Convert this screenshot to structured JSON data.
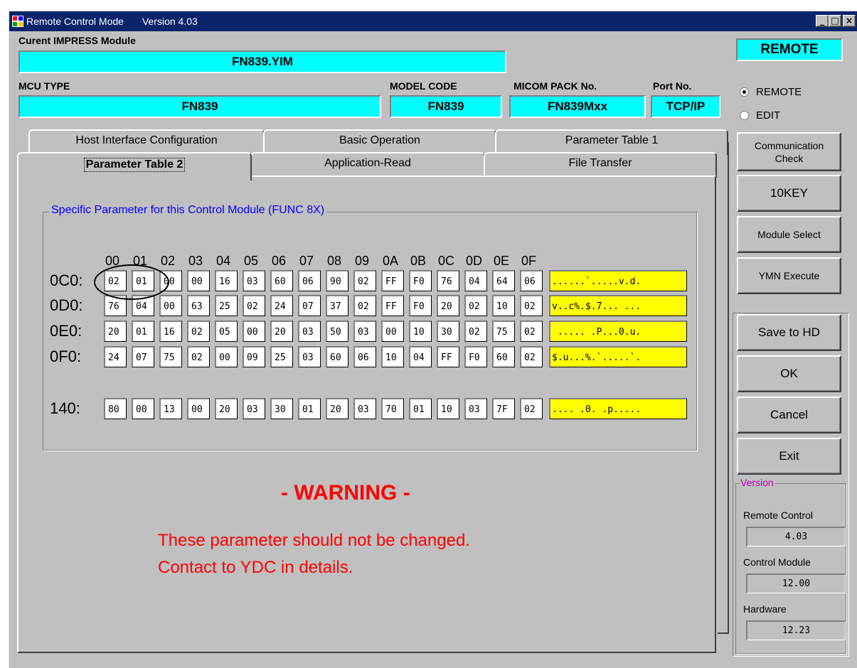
{
  "window": {
    "title": "Remote Control Mode",
    "version_label": "Version  4.03",
    "buttons": [
      "_",
      "□",
      "×"
    ]
  },
  "module": {
    "label": "Curent IMPRESS Module",
    "value": "FN839.YIM"
  },
  "fields": {
    "mcu_type_label": "MCU TYPE",
    "mcu_type": "FN839",
    "model_code_label": "MODEL CODE",
    "model_code": "FN839",
    "micom_pack_label": "MICOM PACK No.",
    "micom_pack": "FN839Mxx",
    "port_label": "Port No.",
    "port": "TCP/IP"
  },
  "mode": {
    "status": "REMOTE",
    "options": [
      {
        "label": "REMOTE",
        "selected": true
      },
      {
        "label": "EDIT",
        "selected": false
      }
    ]
  },
  "side_buttons": {
    "communication_check": [
      "Communication",
      "Check"
    ],
    "tenkey": "10KEY",
    "module_select": "Module Select",
    "ymn_execute": "YMN Execute",
    "save_to_hd": "Save to HD",
    "ok": "OK",
    "cancel": "Cancel",
    "exit": "Exit"
  },
  "version_panel": {
    "title": "Version",
    "remote_control_label": "Remote Control",
    "remote_control": "4.03",
    "control_module_label": "Control Module",
    "control_module": "12.00",
    "hardware_label": "Hardware",
    "hardware": "12.23"
  },
  "tabs": {
    "back_row": [
      "Host Interface Configuration",
      "Basic Operation",
      "Parameter Table 1"
    ],
    "front_row": [
      "Parameter Table 2",
      "Application-Read",
      "File Transfer"
    ],
    "active": "Parameter Table 2"
  },
  "params": {
    "group_title": "Specific Parameter for this Control Module (FUNC 8X)",
    "columns": [
      "00",
      "01",
      "02",
      "03",
      "04",
      "05",
      "06",
      "07",
      "08",
      "09",
      "0A",
      "0B",
      "0C",
      "0D",
      "0E",
      "0F"
    ],
    "rows": [
      {
        "label": "0C0:",
        "cells": [
          "02",
          "01",
          "00",
          "00",
          "16",
          "03",
          "60",
          "06",
          "90",
          "02",
          "FF",
          "F0",
          "76",
          "04",
          "64",
          "06"
        ],
        "ascii": "......`.....v.d."
      },
      {
        "label": "0D0:",
        "cells": [
          "76",
          "04",
          "00",
          "63",
          "25",
          "02",
          "24",
          "07",
          "37",
          "02",
          "FF",
          "F0",
          "20",
          "02",
          "10",
          "02"
        ],
        "ascii": "v..c%.$.7... ..."
      },
      {
        "label": "0E0:",
        "cells": [
          "20",
          "01",
          "16",
          "02",
          "05",
          "00",
          "20",
          "03",
          "50",
          "03",
          "00",
          "10",
          "30",
          "02",
          "75",
          "02"
        ],
        "ascii": " ..... .P...0.u."
      },
      {
        "label": "0F0:",
        "cells": [
          "24",
          "07",
          "75",
          "02",
          "00",
          "09",
          "25",
          "03",
          "60",
          "06",
          "10",
          "04",
          "FF",
          "F0",
          "60",
          "02"
        ],
        "ascii": "$.u...%.`.....`."
      },
      {
        "label": "140:",
        "cells": [
          "80",
          "00",
          "13",
          "00",
          "20",
          "03",
          "30",
          "01",
          "20",
          "03",
          "70",
          "01",
          "10",
          "03",
          "7F",
          "02"
        ],
        "ascii": ".... .0. .p....."
      }
    ]
  },
  "warning": {
    "title": "- WARNING -",
    "line1": "These parameter should not be changed.",
    "line2": "Contact to YDC in details."
  }
}
